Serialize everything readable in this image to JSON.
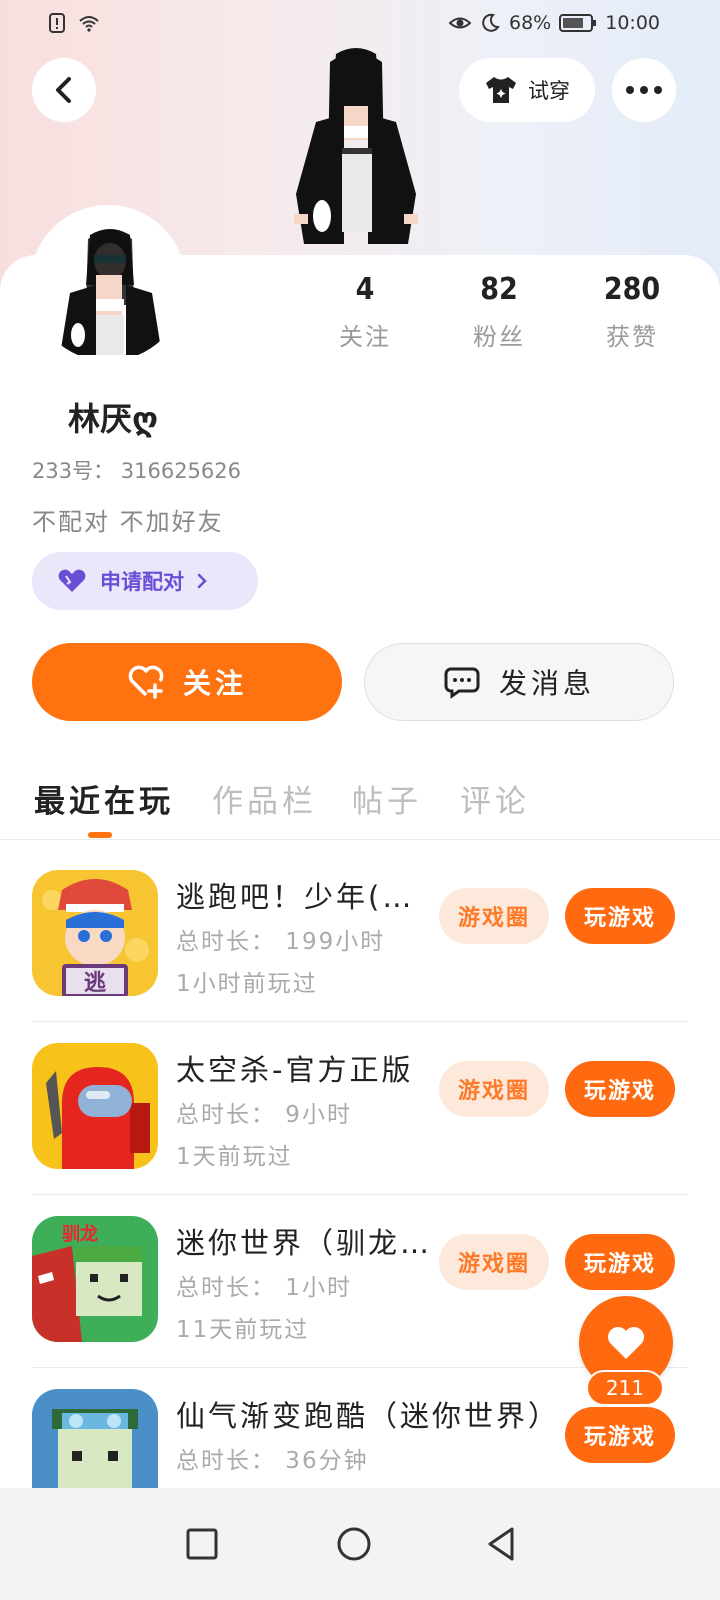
{
  "status_bar": {
    "battery": "68%",
    "time": "10:00",
    "icons": [
      "alert-icon",
      "wifi-icon",
      "eye-icon",
      "moon-icon",
      "battery-icon"
    ]
  },
  "header": {
    "try_on_label": "试穿",
    "icons": [
      "back-icon",
      "tshirt-icon",
      "more-icon"
    ]
  },
  "profile": {
    "name": "林厌ღ",
    "id_line": "233号：  316625626",
    "bio": "不配对  不加好友",
    "pair_button": "申请配对",
    "stats": [
      {
        "value": "4",
        "label": "关注"
      },
      {
        "value": "82",
        "label": "粉丝"
      },
      {
        "value": "280",
        "label": "获赞"
      }
    ]
  },
  "actions": {
    "follow": "关注",
    "message": "发消息"
  },
  "tabs": [
    {
      "label": "最近在玩",
      "active": true
    },
    {
      "label": "作品栏",
      "active": false
    },
    {
      "label": "帖子",
      "active": false
    },
    {
      "label": "评论",
      "active": false
    }
  ],
  "games": [
    {
      "title": "逃跑吧！少年(…",
      "duration": "总时长：  199小时",
      "last_played": "1小时前玩过",
      "circle": "游戏圈",
      "play": "玩游戏",
      "icon_text": "逃"
    },
    {
      "title": "太空杀-官方正版",
      "duration": "总时长：  9小时",
      "last_played": "1天前玩过",
      "circle": "游戏圈",
      "play": "玩游戏"
    },
    {
      "title": "迷你世界（驯龙…",
      "duration": "总时长：  1小时",
      "last_played": "11天前玩过",
      "circle": "游戏圈",
      "play": "玩游戏",
      "icon_text": "驯龙"
    },
    {
      "title": "仙气渐变跑酷（迷你世界）",
      "duration": "总时长：  36分钟",
      "last_played": "",
      "circle": "",
      "play": "玩游戏"
    }
  ],
  "like_fab": {
    "count": "211"
  },
  "colors": {
    "accent": "#ff6a10",
    "pair": "#6a4fd6",
    "tag_bg": "#fde8dc"
  }
}
